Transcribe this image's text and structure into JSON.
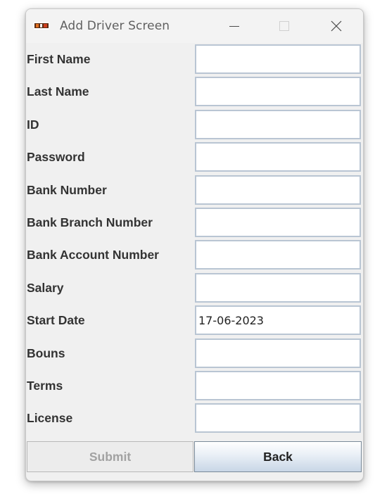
{
  "window": {
    "title": "Add Driver Screen"
  },
  "titlebar_icons": {
    "app": "java-icon",
    "minimize": "minimize-icon",
    "maximize": "maximize-icon",
    "close": "close-icon"
  },
  "form": {
    "fields": [
      {
        "label": "First Name",
        "value": ""
      },
      {
        "label": "Last Name",
        "value": ""
      },
      {
        "label": "ID",
        "value": ""
      },
      {
        "label": "Password",
        "value": ""
      },
      {
        "label": "Bank Number",
        "value": ""
      },
      {
        "label": "Bank Branch Number",
        "value": ""
      },
      {
        "label": "Bank Account Number",
        "value": ""
      },
      {
        "label": "Salary",
        "value": ""
      },
      {
        "label": "Start Date",
        "value": "17-06-2023"
      },
      {
        "label": "Bouns",
        "value": ""
      },
      {
        "label": "Terms",
        "value": ""
      },
      {
        "label": "License",
        "value": ""
      }
    ]
  },
  "buttons": {
    "submit": "Submit",
    "back": "Back"
  },
  "colors": {
    "submit_text_disabled": "#a2a2a2",
    "field_border": "#b9c5d3",
    "label_text": "#333333"
  }
}
